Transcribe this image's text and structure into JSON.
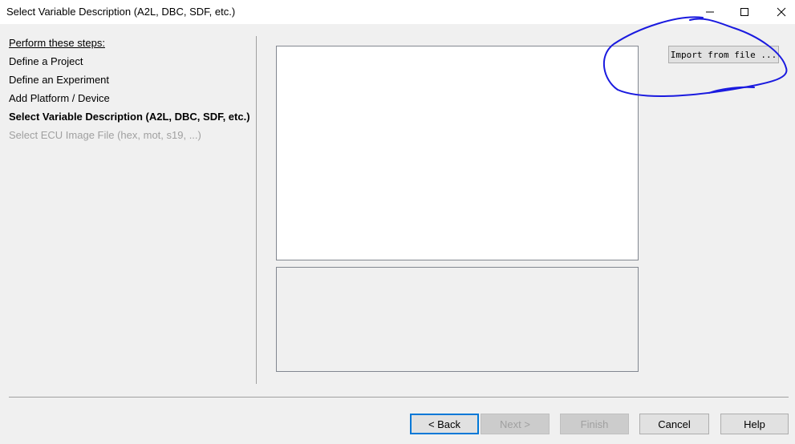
{
  "window": {
    "title": "Select Variable Description (A2L, DBC, SDF, etc.)",
    "controls": {
      "minimize": "–",
      "maximize": "□",
      "close": "✕"
    }
  },
  "steps": {
    "header": "Perform these steps:",
    "items": [
      {
        "label": "Define a Project",
        "state": "done"
      },
      {
        "label": "Define an Experiment",
        "state": "done"
      },
      {
        "label": "Add Platform / Device",
        "state": "done"
      },
      {
        "label": "Select Variable Description (A2L, DBC, SDF, etc.)",
        "state": "current"
      },
      {
        "label": "Select ECU Image File (hex, mot, s19, ...)",
        "state": "disabled"
      }
    ]
  },
  "actions": {
    "import_label": "Import from file ..."
  },
  "buttons": {
    "back": "< Back",
    "next": "Next >",
    "finish": "Finish",
    "cancel": "Cancel",
    "help": "Help"
  },
  "annotation": {
    "color": "#1a1adf",
    "shape": "hand-drawn-ellipse"
  }
}
